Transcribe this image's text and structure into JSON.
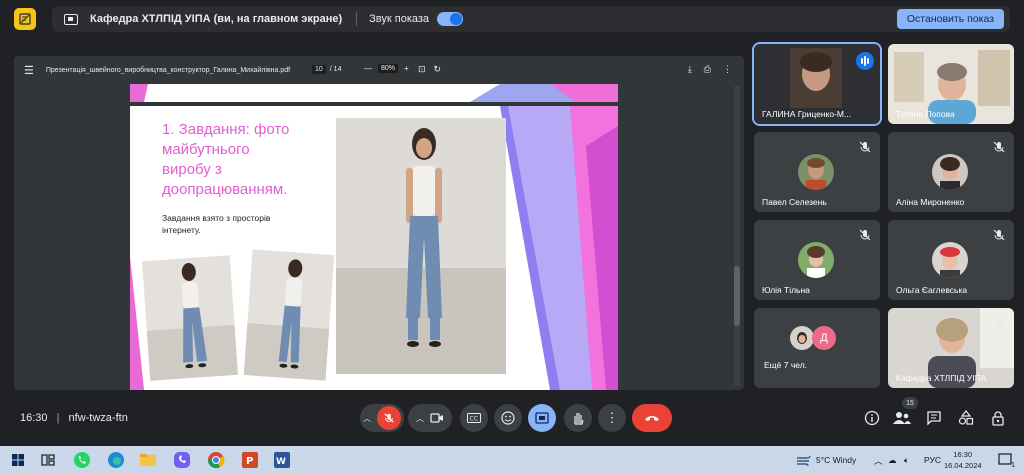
{
  "top_bar": {
    "title": "Кафедра ХТЛПІД УІПА (ви, на главном экране)",
    "sound_label": "Звук показа",
    "sound_on": true,
    "stop_button": "Остановить показ"
  },
  "pdf_viewer": {
    "file_name": "Презентація_швейного_виробництва_конструктор_Галина_Михайлівна.pdf",
    "page_current": "10",
    "page_total": "/ 14",
    "zoom": "80%"
  },
  "slide": {
    "title_lines": [
      "1. Завдання: фото",
      "майбутнього",
      "виробу з",
      "доопрацюванням."
    ],
    "subtitle_lines": [
      "Завдання взято  з просторів",
      "інтернету."
    ],
    "accent_color": "#e05fd3"
  },
  "participants": [
    {
      "name": "ГАЛИНА Гриценко-М...",
      "muted": false,
      "speaking": true
    },
    {
      "name": "Тетяна Попова",
      "muted": false
    },
    {
      "name": "Павел Селезень",
      "muted": true
    },
    {
      "name": "Аліна Мироненко",
      "muted": true
    },
    {
      "name": "Юлія Тільна",
      "muted": true
    },
    {
      "name": "Ольга Єаглевська",
      "muted": true
    },
    {
      "name": "Ещё 7 чел.",
      "initial": "Д"
    },
    {
      "name": "Кафедра ХТЛПІД УІПА",
      "muted": true
    }
  ],
  "bottom_bar": {
    "time": "16:30",
    "separator": "|",
    "meeting_code": "nfw-twza-ftn",
    "people_count": "15"
  },
  "taskbar": {
    "weather": "5°C  Windy",
    "lang": "РУС",
    "clock_time": "16:30",
    "clock_date": "16.04.2024",
    "notif_count": "1"
  }
}
